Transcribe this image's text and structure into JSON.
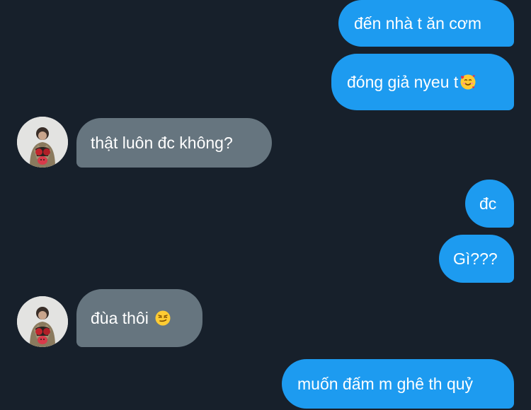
{
  "conversation": {
    "messages": [
      {
        "direction": "outgoing",
        "text": "đến nhà t ăn cơm"
      },
      {
        "direction": "outgoing",
        "text": "đóng giả nyeu t",
        "emoji": "smiling-face-with-hearts-icon"
      },
      {
        "direction": "incoming",
        "text": "thật luôn đc không?"
      },
      {
        "direction": "outgoing",
        "text": "đc"
      },
      {
        "direction": "outgoing",
        "text": "Gì???"
      },
      {
        "direction": "incoming",
        "text": "đùa thôi ",
        "emoji": "smirking-face-icon"
      },
      {
        "direction": "outgoing",
        "text": "muốn đấm m ghê th quỷ"
      }
    ]
  },
  "colors": {
    "background": "#17202b",
    "outgoing_bubble": "#1d9bf0",
    "incoming_bubble": "#66757f",
    "text": "#ffffff"
  }
}
